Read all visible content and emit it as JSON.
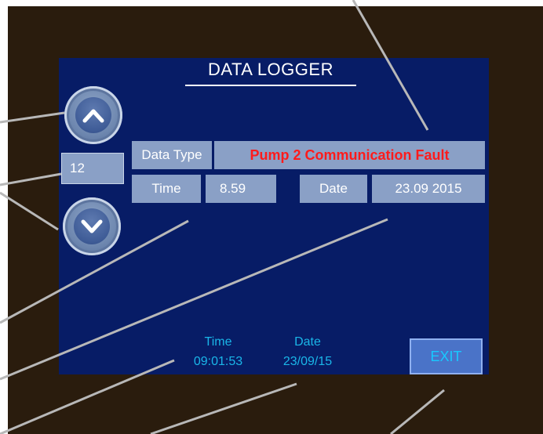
{
  "title": "DATA LOGGER",
  "nav": {
    "up_icon": "chevron-up-icon",
    "down_icon": "chevron-down-icon",
    "record_number": "12"
  },
  "record": {
    "data_type_label": "Data Type",
    "data_type_value": "Pump 2 Communication Fault",
    "time_label": "Time",
    "time_value": "8.59",
    "date_label": "Date",
    "date_value": "23.09  2015"
  },
  "status": {
    "time_label": "Time",
    "time_value": "09:01:53",
    "date_label": "Date",
    "date_value": "23/09/15"
  },
  "exit_label": "EXIT",
  "colors": {
    "screen": "#071c66",
    "cell": "#8aa0c6",
    "fault_text": "#ff1b1b",
    "status_text": "#1ab6e8",
    "bezel": "#2a1c0d"
  }
}
